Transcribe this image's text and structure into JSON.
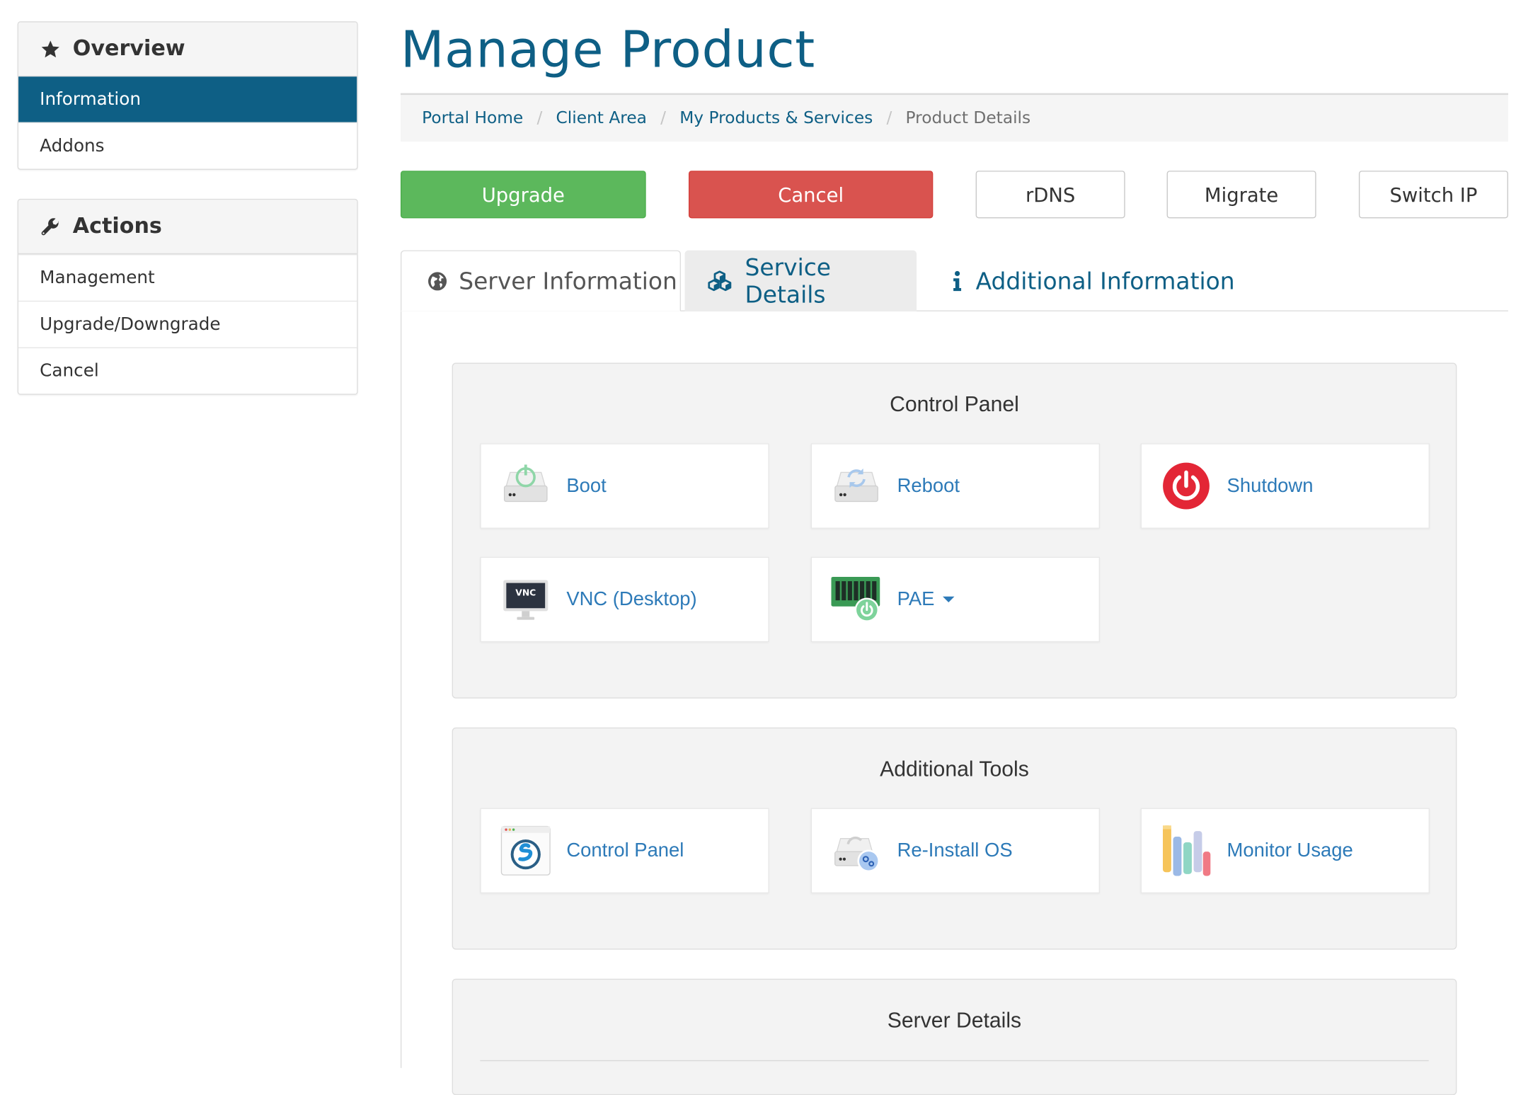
{
  "sidebar": {
    "overview": {
      "title": "Overview",
      "icon": "star-icon",
      "items": [
        {
          "label": "Information",
          "active": true
        },
        {
          "label": "Addons",
          "active": false
        }
      ]
    },
    "actions": {
      "title": "Actions",
      "icon": "wrench-icon",
      "items": [
        {
          "label": "Management"
        },
        {
          "label": "Upgrade/Downgrade"
        },
        {
          "label": "Cancel"
        }
      ]
    }
  },
  "header": {
    "title": "Manage Product",
    "breadcrumb": [
      {
        "label": "Portal Home",
        "active": false
      },
      {
        "label": "Client Area",
        "active": false
      },
      {
        "label": "My Products & Services",
        "active": false
      },
      {
        "label": "Product Details",
        "active": true
      }
    ],
    "breadcrumb_separator": "/"
  },
  "action_buttons": {
    "upgrade": "Upgrade",
    "cancel": "Cancel",
    "rdns": "rDNS",
    "migrate": "Migrate",
    "switch_ip": "Switch IP"
  },
  "tabs": [
    {
      "label": "Server Information",
      "icon": "globe-icon",
      "active": true
    },
    {
      "label": "Service Details",
      "icon": "cubes-icon",
      "active": false
    },
    {
      "label": "Additional Information",
      "icon": "info-icon",
      "active": false
    }
  ],
  "control_panel": {
    "title": "Control Panel",
    "cards": [
      {
        "label": "Boot",
        "icon": "boot-drive-icon"
      },
      {
        "label": "Reboot",
        "icon": "reboot-drive-icon"
      },
      {
        "label": "Shutdown",
        "icon": "power-icon"
      },
      {
        "label": "VNC (Desktop)",
        "icon": "vnc-monitor-icon"
      },
      {
        "label": "PAE",
        "icon": "memory-power-icon",
        "dropdown": true
      }
    ]
  },
  "additional_tools": {
    "title": "Additional Tools",
    "cards": [
      {
        "label": "Control Panel",
        "icon": "control-panel-app-icon"
      },
      {
        "label": "Re-Install OS",
        "icon": "reinstall-drive-icon"
      },
      {
        "label": "Monitor Usage",
        "icon": "usage-bars-icon"
      }
    ]
  },
  "server_details": {
    "title": "Server Details"
  },
  "colors": {
    "brand": "#0e5f85",
    "link": "#2d7ab8",
    "success": "#5cb85c",
    "danger": "#d9534f",
    "power_red": "#e32636"
  }
}
